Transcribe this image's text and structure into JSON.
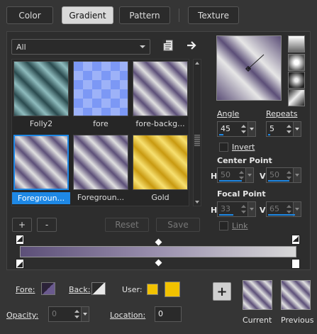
{
  "tabs": [
    {
      "label": "Color",
      "active": false
    },
    {
      "label": "Gradient",
      "active": true
    },
    {
      "label": "Pattern",
      "active": false
    },
    {
      "label": "Texture",
      "active": false
    }
  ],
  "category_select": {
    "value": "All"
  },
  "gradients": [
    {
      "label": "Folly2",
      "selected": false,
      "colors": [
        "#2a4a4e",
        "#8fbcbe"
      ]
    },
    {
      "label": "fore",
      "selected": false,
      "colors": [
        "#6f8ff0",
        "#b9cbff"
      ]
    },
    {
      "label": "fore-backg...",
      "selected": false,
      "colors": [
        "#5c4f78",
        "#e0e0e0"
      ]
    },
    {
      "label": "Foregroun...",
      "selected": true,
      "colors": [
        "#5c4f78",
        "#e0e0e0"
      ]
    },
    {
      "label": "Foregroun...",
      "selected": false,
      "colors": [
        "#5c4f78",
        "#e0e0e0"
      ]
    },
    {
      "label": "Gold",
      "selected": false,
      "colors": [
        "#c99a10",
        "#f7e070"
      ]
    }
  ],
  "buttons": {
    "add": "+",
    "remove": "-",
    "reset": "Reset",
    "save": "Save",
    "add_to_swatches": "+"
  },
  "angle": {
    "label": "Angle",
    "value": "45"
  },
  "repeats": {
    "label": "Repeats",
    "value": "5"
  },
  "invert": {
    "label": "Invert",
    "checked": false
  },
  "center_point": {
    "label": "Center Point",
    "h_label": "H",
    "h_value": "50",
    "v_label": "V",
    "v_value": "50"
  },
  "focal_point": {
    "label": "Focal Point",
    "h_label": "H",
    "h_value": "33",
    "v_label": "V",
    "v_value": "65"
  },
  "link": {
    "label": "Link",
    "checked": false
  },
  "gradient_bar": {
    "start_color": "#5c4f78",
    "end_color": "#d8d8d8"
  },
  "bottom": {
    "fore_label": "Fore:",
    "back_label": "Back:",
    "user_label": "User:",
    "opacity_label": "Opacity:",
    "opacity_value": "0",
    "location_label": "Location:",
    "location_value": "0",
    "current_label": "Current",
    "previous_label": "Previous",
    "user_color": "#f2c200"
  },
  "icons": [
    "list-view-icon",
    "arrow-right-icon",
    "style-linear-icon",
    "style-rectangular-icon",
    "style-sunburst-icon",
    "style-radial-icon"
  ]
}
